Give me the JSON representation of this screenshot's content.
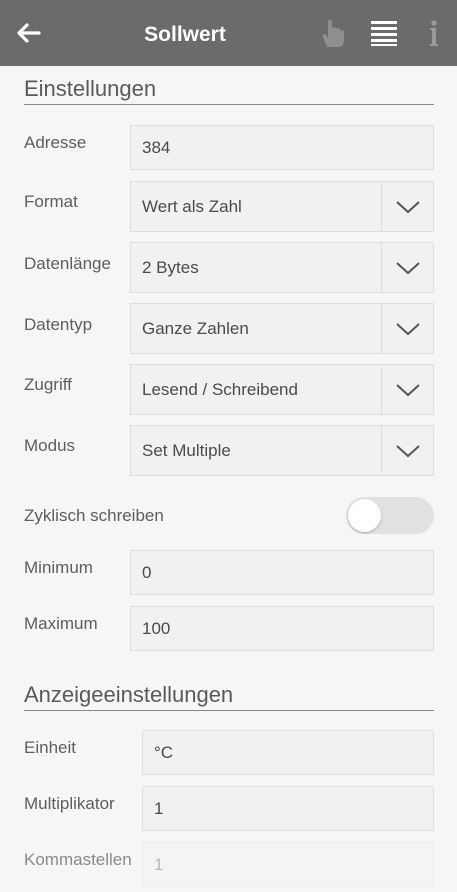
{
  "header": {
    "title": "Sollwert",
    "back_icon": "arrow-left-icon",
    "hand_icon": "hand-pointer-icon",
    "list_icon": "list-icon",
    "info_icon": "info-icon"
  },
  "settings": {
    "heading": "Einstellungen",
    "adresse": {
      "label": "Adresse",
      "value": "384"
    },
    "format": {
      "label": "Format",
      "value": "Wert als Zahl"
    },
    "datenlaenge": {
      "label": "Datenlänge",
      "value": "2 Bytes"
    },
    "datentyp": {
      "label": "Datentyp",
      "value": "Ganze Zahlen"
    },
    "zugriff": {
      "label": "Zugriff",
      "value": "Lesend / Schreibend"
    },
    "modus": {
      "label": "Modus",
      "value": "Set Multiple"
    },
    "zyklisch": {
      "label": "Zyklisch schreiben",
      "on": false
    },
    "minimum": {
      "label": "Minimum",
      "value": "0"
    },
    "maximum": {
      "label": "Maximum",
      "value": "100"
    }
  },
  "display": {
    "heading": "Anzeigeeinstellungen",
    "einheit": {
      "label": "Einheit",
      "value": "°C"
    },
    "multiplikator": {
      "label": "Multiplikator",
      "value": "1"
    },
    "kommastellen": {
      "label": "Kommastellen",
      "value": "1"
    }
  },
  "colors": {
    "header_bg": "#6b6b6b",
    "page_bg": "#f5f6f8",
    "field_bg": "#f0f1f3",
    "toggle_off": "#e1e1e1"
  }
}
